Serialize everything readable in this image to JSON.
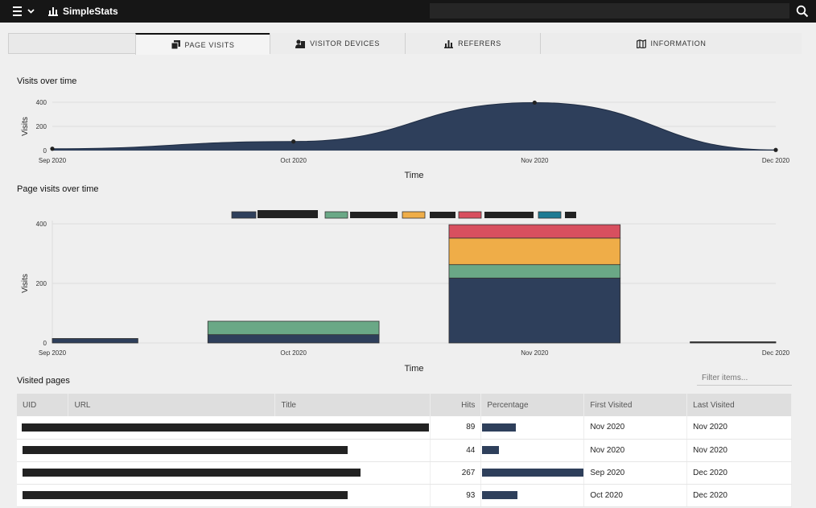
{
  "app": {
    "title": "SimpleStats",
    "search_value": ""
  },
  "tabs": [
    {
      "label": "PAGE VISITS",
      "icon": "pages-icon",
      "active": true
    },
    {
      "label": "VISITOR DEVICES",
      "icon": "devices-icon",
      "active": false
    },
    {
      "label": "REFERERS",
      "icon": "bar-chart-icon",
      "active": false
    },
    {
      "label": "INFORMATION",
      "icon": "map-icon",
      "active": false
    }
  ],
  "visits_chart": {
    "heading": "Visits over time",
    "chart_data": {
      "type": "area",
      "x": [
        "Sep 2020",
        "Oct 2020",
        "Nov 2020",
        "Dec 2020"
      ],
      "values": [
        15,
        75,
        397,
        5
      ],
      "xlabel": "Time",
      "ylabel": "Visits",
      "yticks": [
        0,
        200,
        400
      ],
      "ylim": [
        0,
        400
      ],
      "color": "#2e3f5b",
      "grid": true
    }
  },
  "page_visits_chart": {
    "heading": "Page visits over time",
    "chart_data": {
      "type": "bar",
      "stacked": true,
      "categories": [
        "Sep 2020",
        "Oct 2020",
        "Nov 2020",
        "Dec 2020"
      ],
      "series": [
        {
          "color": "#2e3f5b",
          "values": [
            15,
            28,
            218,
            2
          ]
        },
        {
          "color": "#6aa886",
          "values": [
            0,
            45,
            45,
            2
          ]
        },
        {
          "color": "#efad48",
          "values": [
            0,
            0,
            89,
            0
          ]
        },
        {
          "color": "#d84f5f",
          "values": [
            0,
            0,
            45,
            0
          ]
        },
        {
          "color": "#1d7a93",
          "values": [
            0,
            0,
            0,
            0
          ]
        }
      ],
      "xlabel": "Time",
      "ylabel": "Visits",
      "yticks": [
        0,
        200,
        400
      ],
      "ylim": [
        0,
        400
      ],
      "legend": "top-center"
    }
  },
  "visited_pages": {
    "heading": "Visited pages",
    "filter_placeholder": "Filter items...",
    "columns": [
      "UID",
      "URL",
      "Title",
      "Hits",
      "Percentage",
      "First Visited",
      "Last Visited"
    ],
    "rows": [
      {
        "hits": "89",
        "percentage": 0.33,
        "first": "Nov 2020",
        "last": "Nov 2020"
      },
      {
        "hits": "44",
        "percentage": 0.165,
        "first": "Nov 2020",
        "last": "Nov 2020"
      },
      {
        "hits": "267",
        "percentage": 1.0,
        "first": "Sep 2020",
        "last": "Dec 2020"
      },
      {
        "hits": "93",
        "percentage": 0.35,
        "first": "Oct 2020",
        "last": "Dec 2020"
      }
    ]
  }
}
